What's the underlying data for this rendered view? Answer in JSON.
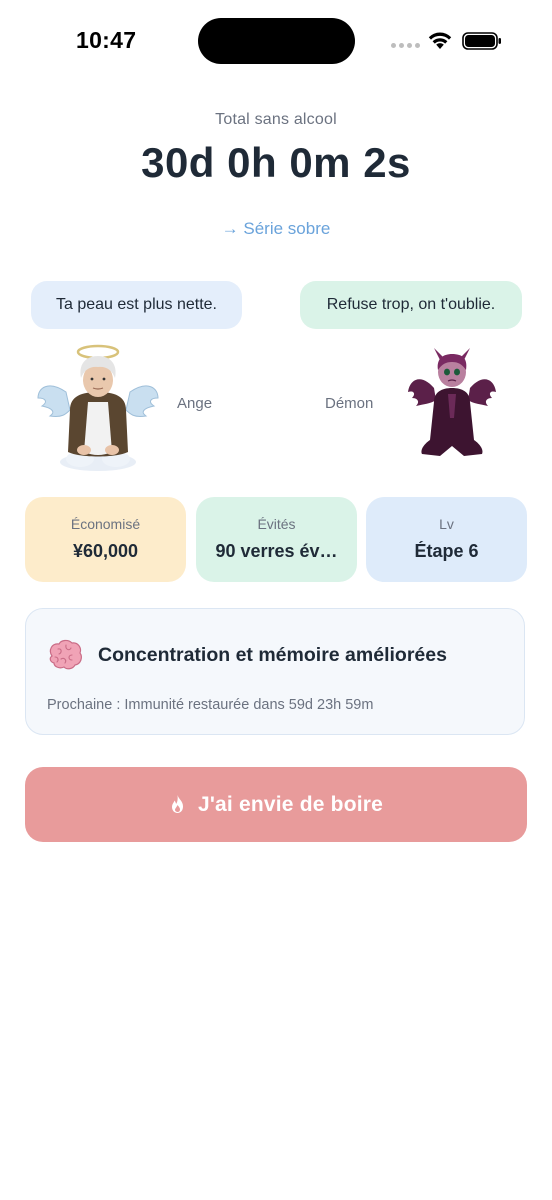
{
  "status_bar": {
    "time": "10:47"
  },
  "header": {
    "total_label": "Total sans alcool",
    "timer": "30d 0h 0m 2s",
    "streak_link": "→ Série sobre"
  },
  "angel": {
    "message": "Ta peau est plus nette.",
    "label": "Ange"
  },
  "demon": {
    "message": "Refuse trop, on t'oublie.",
    "label": "Démon"
  },
  "stats": {
    "saved": {
      "label": "Économisé",
      "value": "¥60,000"
    },
    "avoided": {
      "label": "Évités",
      "value": "90 verres év…"
    },
    "level": {
      "label": "Lv",
      "value": "Étape 6"
    }
  },
  "milestone": {
    "icon": "brain-icon",
    "title": "Concentration et mémoire améliorées",
    "next": "Prochaine : Immunité restaurée dans 59d 23h 59m"
  },
  "craving_button": {
    "icon": "flame-icon",
    "label": "J'ai envie de boire"
  },
  "colors": {
    "accent_link": "#6aa3db",
    "craving_button": "#e89b9b",
    "saved_card": "#fdeccb",
    "avoided_card": "#daf3e8",
    "level_card": "#deebfa",
    "angel_bubble": "#e4eefb",
    "demon_bubble": "#daf3e8"
  }
}
